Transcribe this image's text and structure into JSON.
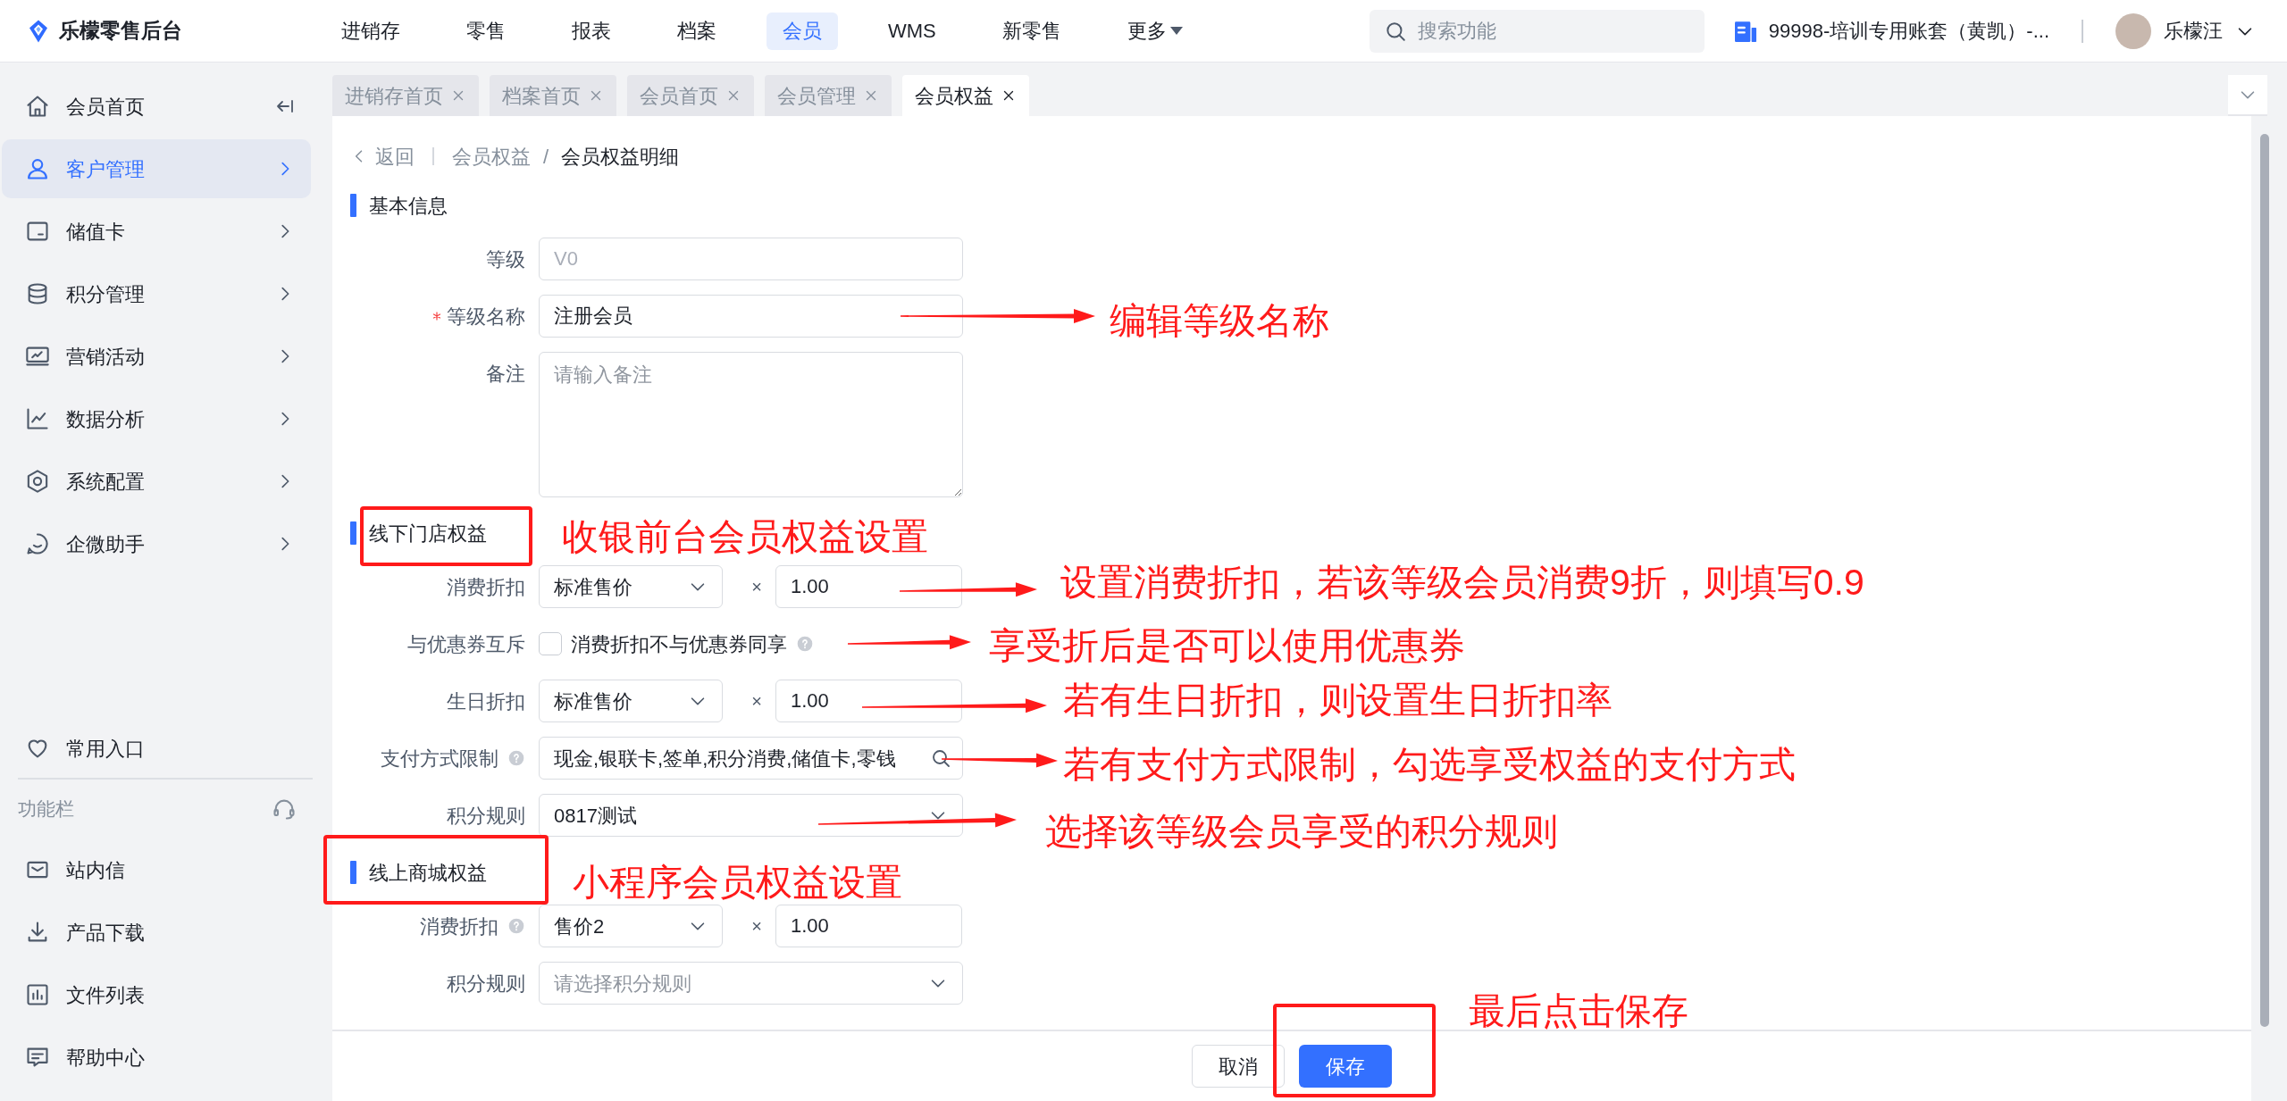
{
  "app": {
    "title": "乐檬零售后台"
  },
  "nav": [
    {
      "label": "进销存",
      "selected": false,
      "has_menu": false
    },
    {
      "label": "零售",
      "selected": false,
      "has_menu": false
    },
    {
      "label": "报表",
      "selected": false,
      "has_menu": false
    },
    {
      "label": "档案",
      "selected": false,
      "has_menu": false
    },
    {
      "label": "会员",
      "selected": true,
      "has_menu": false
    },
    {
      "label": "WMS",
      "selected": false,
      "has_menu": false
    },
    {
      "label": "新零售",
      "selected": false,
      "has_menu": false
    },
    {
      "label": "更多",
      "selected": false,
      "has_menu": true
    }
  ],
  "search": {
    "placeholder": "搜索功能"
  },
  "account": {
    "name": "99998-培训专用账套（黄凯）-..."
  },
  "user": {
    "name": "乐檬汪"
  },
  "sidebar": {
    "items": [
      {
        "label": "会员首页",
        "selected": false,
        "expandable": false
      },
      {
        "label": "客户管理",
        "selected": true,
        "expandable": true
      },
      {
        "label": "储值卡",
        "selected": false,
        "expandable": true
      },
      {
        "label": "积分管理",
        "selected": false,
        "expandable": true
      },
      {
        "label": "营销活动",
        "selected": false,
        "expandable": true
      },
      {
        "label": "数据分析",
        "selected": false,
        "expandable": true
      },
      {
        "label": "系统配置",
        "selected": false,
        "expandable": true
      },
      {
        "label": "企微助手",
        "selected": false,
        "expandable": true
      }
    ],
    "shortcut": {
      "label": "常用入口"
    },
    "toolbar": {
      "title": "功能栏",
      "items": [
        {
          "label": "站内信"
        },
        {
          "label": "产品下载"
        },
        {
          "label": "文件列表"
        },
        {
          "label": "帮助中心"
        }
      ]
    }
  },
  "tabs": [
    {
      "label": "进销存首页",
      "selected": false
    },
    {
      "label": "档案首页",
      "selected": false
    },
    {
      "label": "会员首页",
      "selected": false
    },
    {
      "label": "会员管理",
      "selected": false
    },
    {
      "label": "会员权益",
      "selected": true
    }
  ],
  "breadcrumb": {
    "back": "返回",
    "items": [
      "会员权益",
      "会员权益明细"
    ],
    "separator": "/"
  },
  "sections": [
    {
      "title": "基本信息",
      "highlighted": false,
      "fields": [
        {
          "kind": "input",
          "label": "等级",
          "value": "V0",
          "disabled": true,
          "required": false,
          "help": false
        },
        {
          "kind": "input",
          "label": "等级名称",
          "value": "注册会员",
          "disabled": false,
          "required": true,
          "help": false
        },
        {
          "kind": "textarea",
          "label": "备注",
          "placeholder": "请输入备注",
          "required": false,
          "help": false
        }
      ]
    },
    {
      "title": "线下门店权益",
      "highlighted": true,
      "fields": [
        {
          "kind": "price_factor",
          "label": "消费折扣",
          "select": "标准售价",
          "operator": "×",
          "factor": "1.00",
          "required": false,
          "help": false
        },
        {
          "kind": "checkbox",
          "label": "与优惠券互斥",
          "checked": false,
          "text": "消费折扣不与优惠券同享",
          "required": false,
          "help": false
        },
        {
          "kind": "price_factor",
          "label": "生日折扣",
          "select": "标准售价",
          "operator": "×",
          "factor": "1.00",
          "required": false,
          "help": false
        },
        {
          "kind": "search_input",
          "label": "支付方式限制",
          "value": "现金,银联卡,签单,积分消费,储值卡,零钱",
          "required": false,
          "help": true
        },
        {
          "kind": "select",
          "label": "积分规则",
          "value": "0817测试",
          "required": false,
          "help": false
        }
      ]
    },
    {
      "title": "线上商城权益",
      "highlighted": true,
      "fields": [
        {
          "kind": "price_factor",
          "label": "消费折扣",
          "select": "售价2",
          "operator": "×",
          "factor": "1.00",
          "required": false,
          "help": true
        },
        {
          "kind": "select",
          "label": "积分规则",
          "placeholder": "请选择积分规则",
          "required": false,
          "help": false
        }
      ]
    }
  ],
  "footer": {
    "buttons": [
      {
        "label": "取消",
        "kind": "default",
        "highlighted": false
      },
      {
        "label": "保存",
        "kind": "primary",
        "highlighted": true
      }
    ]
  },
  "annotations": [
    {
      "text": "编辑等级名称"
    },
    {
      "text": "收银前台会员权益设置"
    },
    {
      "text": "设置消费折扣，若该等级会员消费9折，则填写0.9"
    },
    {
      "text": "享受折后是否可以使用优惠券"
    },
    {
      "text": "若有生日折扣，则设置生日折扣率"
    },
    {
      "text": "若有支付方式限制，勾选享受权益的支付方式"
    },
    {
      "text": "选择该等级会员享受的积分规则"
    },
    {
      "text": "小程序会员权益设置"
    },
    {
      "text": "最后点击保存"
    }
  ]
}
